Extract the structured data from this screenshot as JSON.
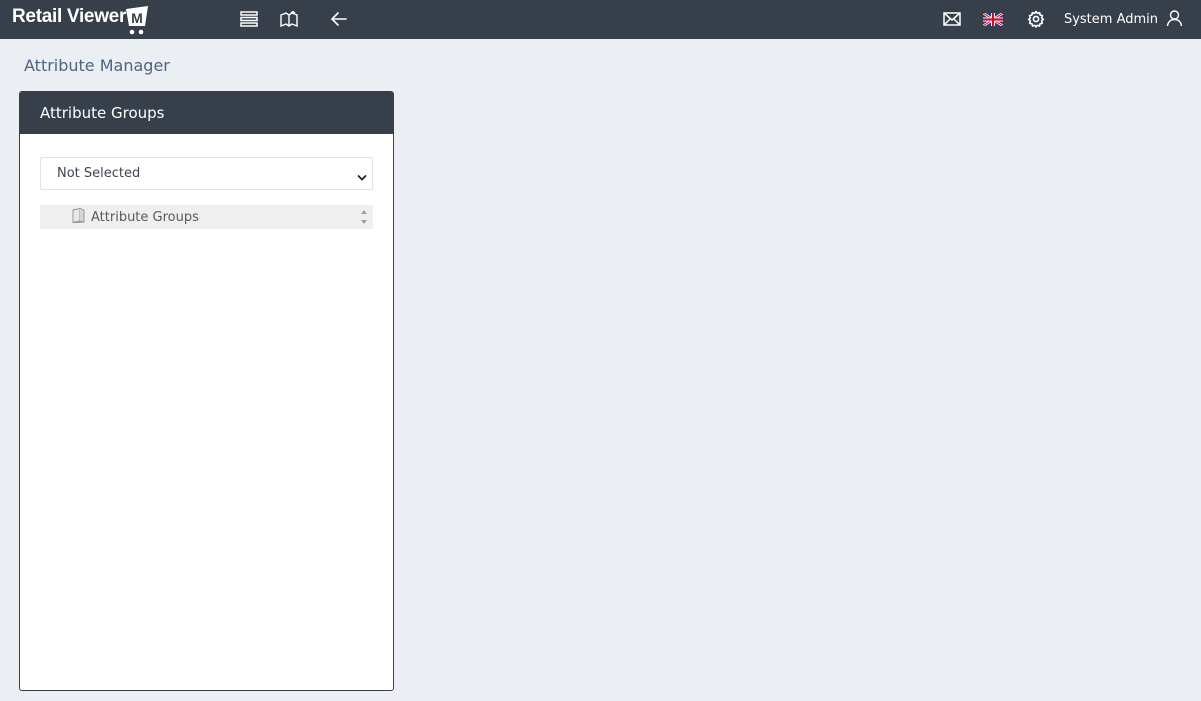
{
  "app": {
    "logo_text": "Retail Viewer",
    "logo_badge": "M"
  },
  "topbar": {
    "icons": {
      "list": "list-icon",
      "catalog": "book-open-icon",
      "back": "arrow-left-icon",
      "mail": "mail-icon",
      "language": "uk-flag-icon",
      "settings": "gear-icon",
      "user": "user-icon"
    },
    "username": "System Admin"
  },
  "page": {
    "title": "Attribute Manager"
  },
  "panel": {
    "title": "Attribute Groups",
    "select_value": "Not Selected",
    "tree": {
      "items": [
        {
          "label": "Attribute Groups",
          "icon": "folder-icon"
        }
      ]
    }
  },
  "colors": {
    "topbar_bg": "#373f4b",
    "page_bg": "#ebeef3",
    "title_text": "#4d6482"
  }
}
